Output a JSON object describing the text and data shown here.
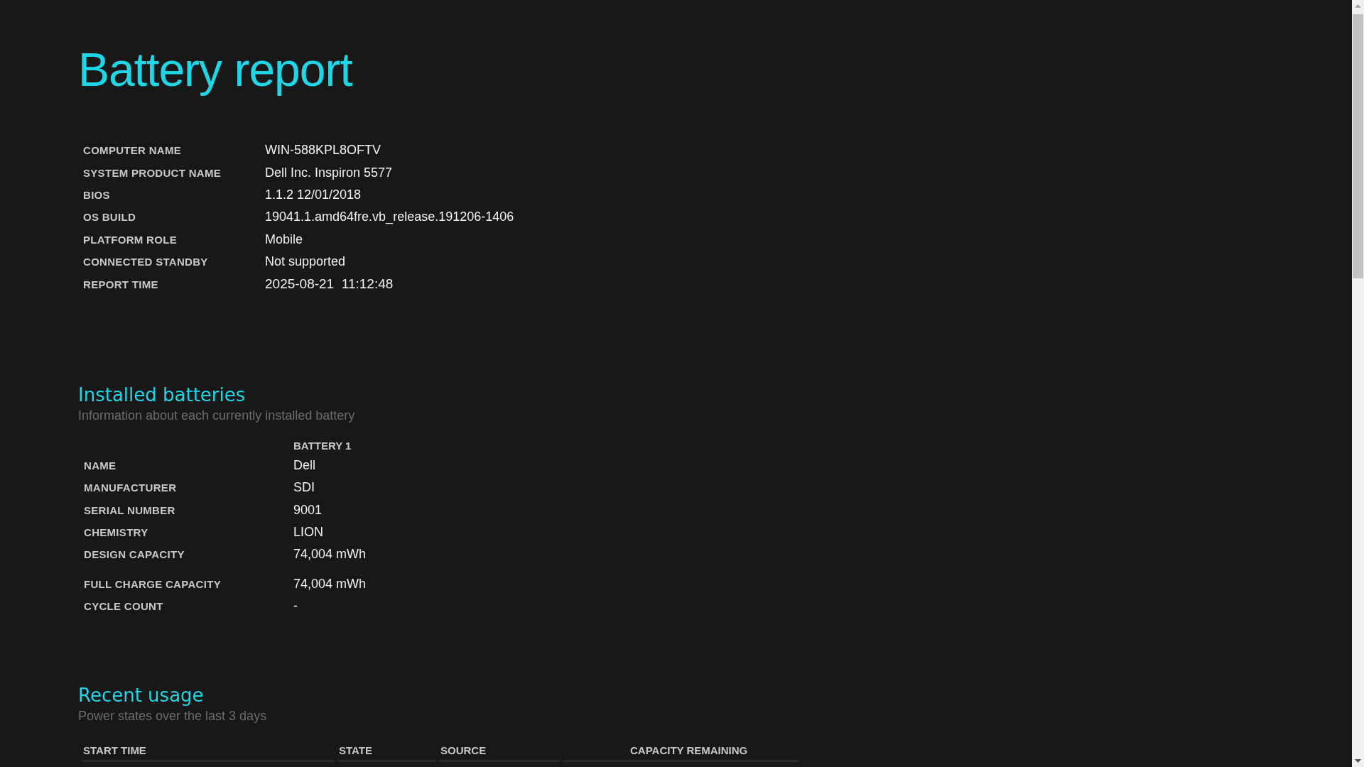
{
  "title": "Battery report",
  "system_info": [
    {
      "label": "COMPUTER NAME",
      "value": "WIN-588KPL8OFTV"
    },
    {
      "label": "SYSTEM PRODUCT NAME",
      "value": "Dell Inc. Inspiron 5577"
    },
    {
      "label": "BIOS",
      "value": "1.1.2 12/01/2018"
    },
    {
      "label": "OS BUILD",
      "value": "19041.1.amd64fre.vb_release.191206-1406"
    },
    {
      "label": "PLATFORM ROLE",
      "value": "Mobile"
    },
    {
      "label": "CONNECTED STANDBY",
      "value": "Not supported"
    },
    {
      "label": "REPORT TIME",
      "value": "2025-08-21  11:12:48"
    }
  ],
  "installed_batteries": {
    "heading": "Installed batteries",
    "subtitle": "Information about each currently installed battery",
    "column": "BATTERY 1",
    "rows": [
      {
        "label": "NAME",
        "value": "Dell"
      },
      {
        "label": "MANUFACTURER",
        "value": "SDI"
      },
      {
        "label": "SERIAL NUMBER",
        "value": "9001"
      },
      {
        "label": "CHEMISTRY",
        "value": "LION"
      },
      {
        "label": "DESIGN CAPACITY",
        "value": "74,004 mWh"
      },
      {
        "label": "FULL CHARGE CAPACITY",
        "value": "74,004 mWh"
      },
      {
        "label": "CYCLE COUNT",
        "value": "-"
      }
    ]
  },
  "recent_usage": {
    "heading": "Recent usage",
    "subtitle": "Power states over the last 3 days",
    "columns": [
      "START TIME",
      "STATE",
      "SOURCE",
      "CAPACITY REMAINING"
    ]
  }
}
